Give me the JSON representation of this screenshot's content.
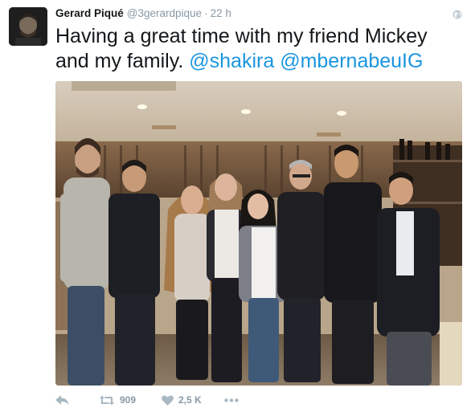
{
  "tweet": {
    "author_name": "Gerard Piqué",
    "handle": "@3gerardpique",
    "separator": "·",
    "time": "22 h",
    "text_plain": "Having a great time with my friend Mickey and my family.",
    "mention_1": "@shakira",
    "mention_2": "@mbernabeuIG",
    "icons": {
      "globe": "globe-icon",
      "reply": "reply-icon",
      "retweet": "retweet-icon",
      "like": "heart-icon",
      "more": "more-icon"
    },
    "actions": {
      "retweet_count": "909",
      "like_count": "2,5 K"
    },
    "colors": {
      "mention": "#1b95e0",
      "meta": "#8899a6",
      "text": "#14171a"
    }
  }
}
